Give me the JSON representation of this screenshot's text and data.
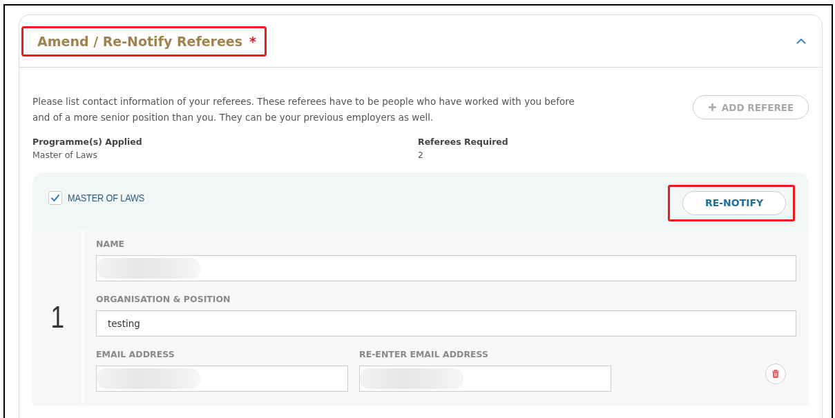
{
  "section": {
    "title": "Amend / Re-Notify Referees",
    "required_mark": "*",
    "expanded": true,
    "highlighted": true
  },
  "intro": "Please list contact information of your referees. These referees have to be people who have worked with you before and of a more senior position than you. They can be your previous employers as well.",
  "add_button": {
    "label": "ADD REFEREE",
    "disabled": true
  },
  "info": [
    {
      "label": "Programme(s) Applied",
      "value": "Master of Laws"
    },
    {
      "label": "Referees Required",
      "value": "2"
    }
  ],
  "programme": {
    "name": "MASTER OF LAWS",
    "checked": true,
    "renotify": {
      "label": "RE-NOTIFY",
      "highlighted": true
    }
  },
  "referees": [
    {
      "number": "1",
      "rows": [
        [
          {
            "label": "NAME",
            "redacted": true
          }
        ],
        [
          {
            "label": "ORGANISATION & POSITION",
            "value": "testing",
            "redacted": false
          }
        ],
        [
          {
            "label": "EMAIL ADDRESS",
            "redacted": true
          },
          {
            "label": "RE-ENTER EMAIL ADDRESS",
            "redacted": true
          }
        ]
      ]
    }
  ]
}
